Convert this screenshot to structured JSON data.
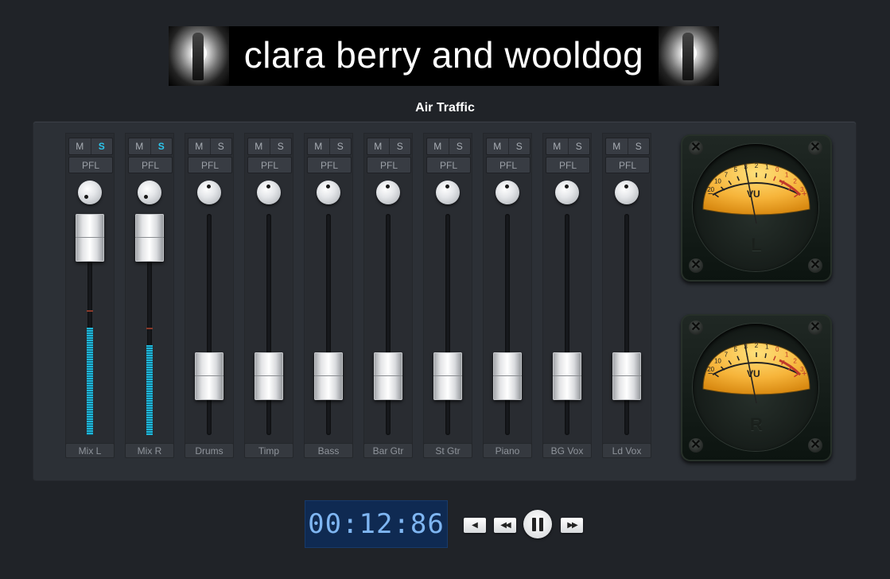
{
  "banner": {
    "title": "clara berry and wooldog"
  },
  "song": {
    "title": "Air Traffic"
  },
  "channels": [
    {
      "label": "Mix L",
      "mute": "M",
      "solo": "S",
      "solo_active": true,
      "pfl": "PFL",
      "fader_level": 1.0,
      "meter_level": 0.66
    },
    {
      "label": "Mix R",
      "mute": "M",
      "solo": "S",
      "solo_active": true,
      "pfl": "PFL",
      "fader_level": 1.0,
      "meter_level": 0.55
    },
    {
      "label": "Drums",
      "mute": "M",
      "solo": "S",
      "solo_active": false,
      "pfl": "PFL",
      "fader_level": 0.2,
      "meter_level": 0
    },
    {
      "label": "Timp",
      "mute": "M",
      "solo": "S",
      "solo_active": false,
      "pfl": "PFL",
      "fader_level": 0.2,
      "meter_level": 0
    },
    {
      "label": "Bass",
      "mute": "M",
      "solo": "S",
      "solo_active": false,
      "pfl": "PFL",
      "fader_level": 0.2,
      "meter_level": 0
    },
    {
      "label": "Bar Gtr",
      "mute": "M",
      "solo": "S",
      "solo_active": false,
      "pfl": "PFL",
      "fader_level": 0.2,
      "meter_level": 0
    },
    {
      "label": "St Gtr",
      "mute": "M",
      "solo": "S",
      "solo_active": false,
      "pfl": "PFL",
      "fader_level": 0.2,
      "meter_level": 0
    },
    {
      "label": "Piano",
      "mute": "M",
      "solo": "S",
      "solo_active": false,
      "pfl": "PFL",
      "fader_level": 0.2,
      "meter_level": 0
    },
    {
      "label": "BG Vox",
      "mute": "M",
      "solo": "S",
      "solo_active": false,
      "pfl": "PFL",
      "fader_level": 0.2,
      "meter_level": 0
    },
    {
      "label": "Ld Vox",
      "mute": "M",
      "solo": "S",
      "solo_active": false,
      "pfl": "PFL",
      "fader_level": 0.2,
      "meter_level": 0
    }
  ],
  "vu_meters": [
    {
      "channel": "L",
      "label": "VU",
      "scale": [
        "20",
        "10",
        "7",
        "5",
        "3",
        "2",
        "1",
        "0",
        "1",
        "2",
        "3"
      ],
      "minus": "−",
      "plus": "+",
      "needle_value": 0.4
    },
    {
      "channel": "R",
      "label": "VU",
      "scale": [
        "20",
        "10",
        "7",
        "5",
        "3",
        "2",
        "1",
        "0",
        "1",
        "2",
        "3"
      ],
      "minus": "−",
      "plus": "+",
      "needle_value": 0.4
    }
  ],
  "transport": {
    "time": "00:12:86",
    "stop_icon": "◀",
    "rewind_icon": "◀◀",
    "forward_icon": "▶▶"
  },
  "colors": {
    "solo_active": "#2cc7ee",
    "meter": "#1fb7da",
    "vu_face": "#f6b43a",
    "timer_bg": "#0f2a52",
    "timer_text": "#7fb6f2"
  }
}
